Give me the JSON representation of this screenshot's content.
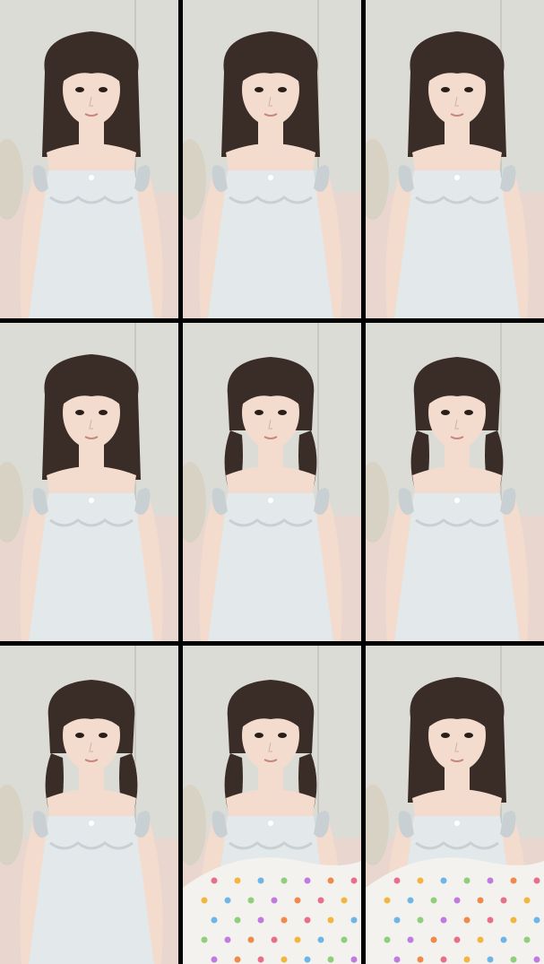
{
  "layout": {
    "rows": 3,
    "columns": 3,
    "divider_color": "#000000"
  },
  "palette": {
    "wall": "#dcdcd6",
    "wall_shadow": "#c9c9c2",
    "bed": "#e9d6cf",
    "skin": "#f3dccd",
    "hair": "#3a2c27",
    "dress": "#e3e8ea",
    "dress_shadow": "#c8d0d4",
    "blanket": "#f4f2ee"
  },
  "tiles": [
    {
      "id": "1",
      "variant": "dress",
      "hair_style": "loose"
    },
    {
      "id": "2",
      "variant": "dress",
      "hair_style": "loose"
    },
    {
      "id": "3",
      "variant": "dress",
      "hair_style": "loose"
    },
    {
      "id": "4",
      "variant": "dress",
      "hair_style": "loose"
    },
    {
      "id": "5",
      "variant": "dress",
      "hair_style": "pigtails"
    },
    {
      "id": "6",
      "variant": "dress",
      "hair_style": "pigtails"
    },
    {
      "id": "7",
      "variant": "dress",
      "hair_style": "pigtails"
    },
    {
      "id": "8",
      "variant": "blanket",
      "hair_style": "pigtails"
    },
    {
      "id": "9",
      "variant": "blanket",
      "hair_style": "loose"
    }
  ]
}
